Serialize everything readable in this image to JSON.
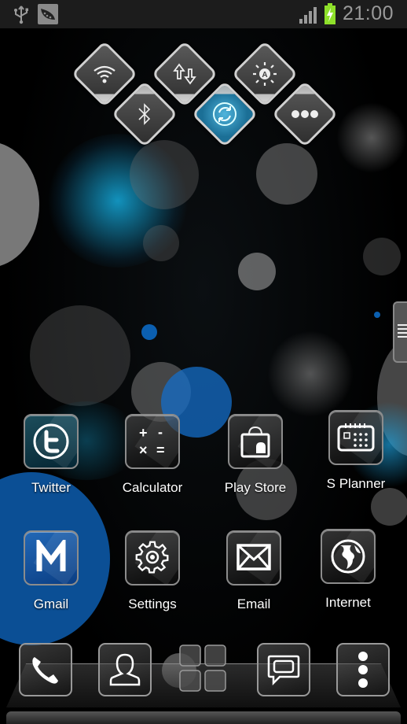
{
  "status_bar": {
    "left_icons": [
      "usb-icon",
      "peapod-notification-icon"
    ],
    "right_icons": [
      "signal-icon",
      "battery-charging-icon"
    ],
    "battery_color": "#8ee02a",
    "time": "21:00"
  },
  "quick_toggles": [
    {
      "name": "wifi",
      "icon": "wifi-icon",
      "active": false
    },
    {
      "name": "mobile-data",
      "icon": "data-arrows-icon",
      "active": false
    },
    {
      "name": "auto-brightness",
      "icon": "brightness-auto-icon",
      "active": false
    },
    {
      "name": "bluetooth",
      "icon": "bluetooth-icon",
      "active": false
    },
    {
      "name": "sync",
      "icon": "sync-icon",
      "active": true
    },
    {
      "name": "more",
      "icon": "more-dots-icon",
      "active": false
    }
  ],
  "apps": [
    {
      "label": "Twitter",
      "icon": "twitter-icon"
    },
    {
      "label": "Calculator",
      "icon": "calculator-icon"
    },
    {
      "label": "Play Store",
      "icon": "play-store-icon"
    },
    {
      "label": "S Planner",
      "icon": "calendar-icon"
    },
    {
      "label": "Gmail",
      "icon": "gmail-icon"
    },
    {
      "label": "Settings",
      "icon": "gear-icon"
    },
    {
      "label": "Email",
      "icon": "envelope-icon"
    },
    {
      "label": "Internet",
      "icon": "globe-icon"
    }
  ],
  "dock": [
    {
      "name": "phone",
      "icon": "phone-icon"
    },
    {
      "name": "contacts",
      "icon": "contact-icon"
    },
    {
      "name": "apps",
      "icon": "app-grid-icon"
    },
    {
      "name": "messaging",
      "icon": "message-icon"
    },
    {
      "name": "menu",
      "icon": "more-vertical-icon"
    }
  ],
  "colors": {
    "accent": "#2aa0d4",
    "blue_bokeh": "#0a5aa8"
  }
}
